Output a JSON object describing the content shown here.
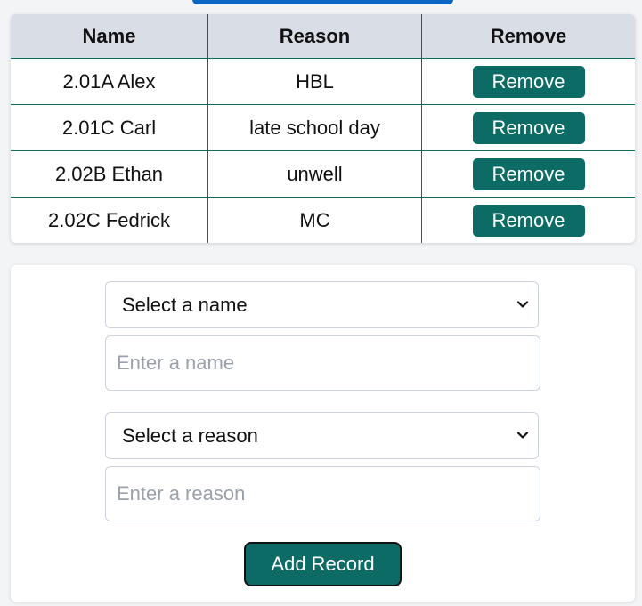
{
  "table": {
    "headers": {
      "name": "Name",
      "reason": "Reason",
      "remove": "Remove"
    },
    "rows": [
      {
        "name": "2.01A Alex",
        "reason": "HBL",
        "action": "Remove"
      },
      {
        "name": "2.01C Carl",
        "reason": "late school day",
        "action": "Remove"
      },
      {
        "name": "2.02B Ethan",
        "reason": "unwell",
        "action": "Remove"
      },
      {
        "name": "2.02C Fedrick",
        "reason": "MC",
        "action": "Remove"
      }
    ]
  },
  "form": {
    "name_select": "Select a name",
    "name_placeholder": "Enter a name",
    "reason_select": "Select a reason",
    "reason_placeholder": "Enter a reason",
    "submit_label": "Add Record"
  },
  "colors": {
    "accent": "#0d6b66",
    "header_bg": "#d8dde6",
    "top_bar": "#0a66c2"
  },
  "icons": {
    "dropdown": "chevron-down-icon"
  }
}
